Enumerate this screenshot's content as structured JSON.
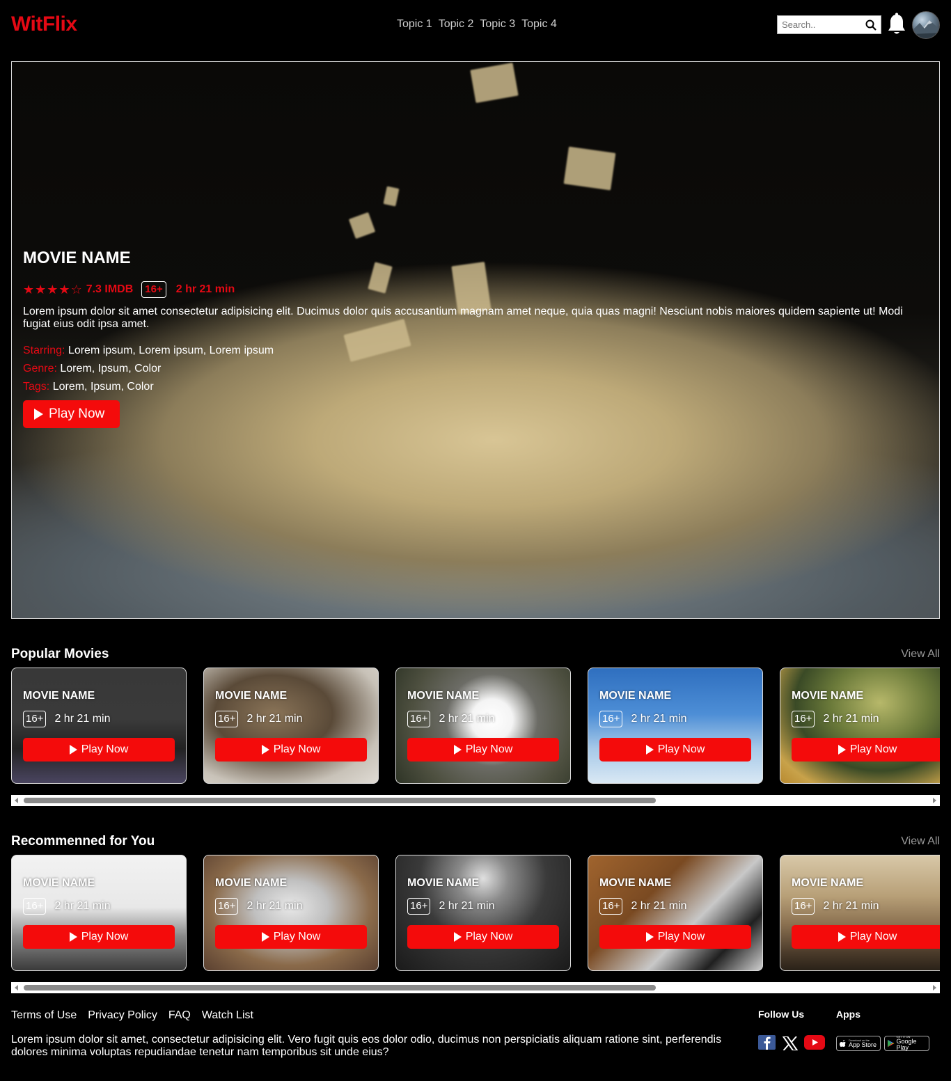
{
  "brand": {
    "name": "WitFlix",
    "accent": "#e50914"
  },
  "nav": [
    "Topic 1",
    "Topic 2",
    "Topic 3",
    "Topic 4"
  ],
  "search": {
    "placeholder": "Search.."
  },
  "hero": {
    "title": "MOVIE NAME",
    "rating": "7.3 IMDB",
    "stars": 4,
    "age": "16+",
    "duration": "2 hr 21 min",
    "description": "Lorem ipsum dolor sit amet consectetur adipisicing elit. Ducimus dolor quis accusantium magnam amet neque, quia quas magni! Nesciunt nobis maiores quidem sapiente ut! Modi fugiat eius odit ipsa amet.",
    "starring_label": "Starring:",
    "starring": "Lorem ipsum, Lorem ipsum, Lorem ipsum",
    "genre_label": "Genre:",
    "genre": "Lorem, Ipsum, Color",
    "tags_label": "Tags:",
    "tags": "Lorem, Ipsum, Color",
    "play_label": "Play Now"
  },
  "popular": {
    "title": "Popular Movies",
    "view_all": "View All",
    "cards": [
      {
        "title": "MOVIE NAME",
        "age": "16+",
        "duration": "2 hr 21 min",
        "play": "Play Now"
      },
      {
        "title": "MOVIE NAME",
        "age": "16+",
        "duration": "2 hr 21 min",
        "play": "Play Now"
      },
      {
        "title": "MOVIE NAME",
        "age": "16+",
        "duration": "2 hr 21 min",
        "play": "Play Now"
      },
      {
        "title": "MOVIE NAME",
        "age": "16+",
        "duration": "2 hr 21 min",
        "play": "Play Now"
      },
      {
        "title": "MOVIE NAME",
        "age": "16+",
        "duration": "2 hr 21 min",
        "play": "Play Now"
      }
    ]
  },
  "recommended": {
    "title": "Recommenned for You",
    "view_all": "View All",
    "cards": [
      {
        "title": "MOVIE NAME",
        "age": "16+",
        "duration": "2 hr 21 min",
        "play": "Play Now"
      },
      {
        "title": "MOVIE NAME",
        "age": "16+",
        "duration": "2 hr 21 min",
        "play": "Play Now"
      },
      {
        "title": "MOVIE NAME",
        "age": "16+",
        "duration": "2 hr 21 min",
        "play": "Play Now"
      },
      {
        "title": "MOVIE NAME",
        "age": "16+",
        "duration": "2 hr 21 min",
        "play": "Play Now"
      },
      {
        "title": "MOVIE NAME",
        "age": "16+",
        "duration": "2 hr 21 min",
        "play": "Play Now"
      }
    ]
  },
  "footer": {
    "links": [
      "Terms of Use",
      "Privacy Policy",
      "FAQ",
      "Watch List"
    ],
    "text": "Lorem ipsum dolor sit amet, consectetur adipisicing elit. Vero fugit quis eos dolor odio, ducimus non perspiciatis aliquam ratione sint, perferendis dolores minima voluptas repudiandae tenetur nam temporibus sit unde eius?",
    "follow_title": "Follow Us",
    "apps_title": "Apps",
    "social_icons": [
      "facebook-icon",
      "x-icon",
      "youtube-icon"
    ],
    "app_store": {
      "small": "Download on the",
      "big": "App Store"
    },
    "google_play": {
      "small": "GET IT ON",
      "big": "Google Play"
    }
  }
}
